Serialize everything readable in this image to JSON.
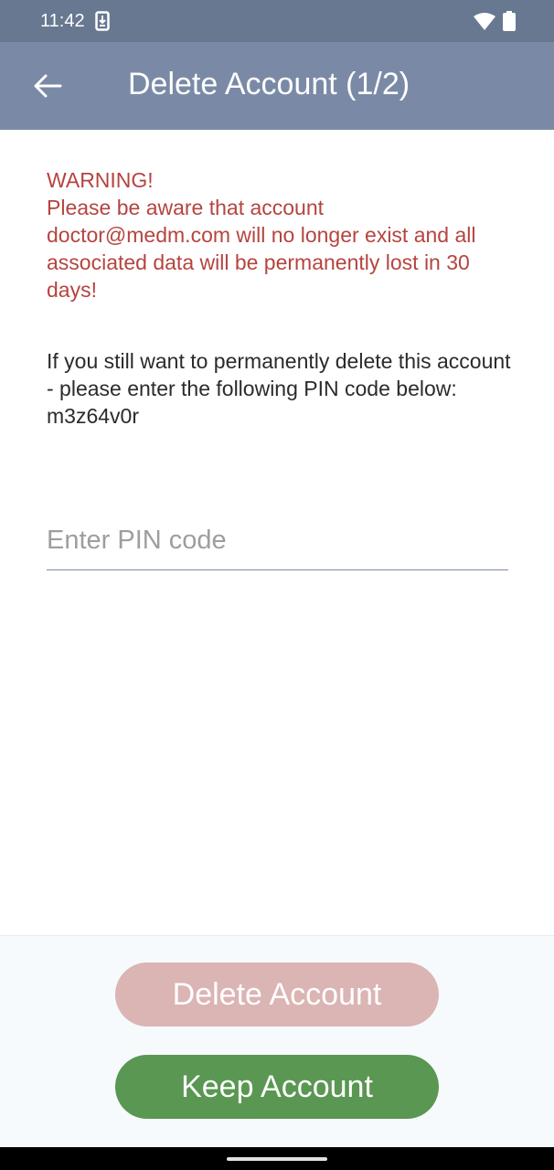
{
  "status_bar": {
    "time": "11:42",
    "icons": [
      "download-icon",
      "wifi-icon",
      "battery-icon"
    ]
  },
  "app_bar": {
    "title": "Delete Account (1/2)",
    "back_icon": "arrow-left-icon"
  },
  "warning": {
    "heading": "WARNING!",
    "message": "Please be aware that account doctor@medm.com will no longer exist and all associated data will be permanently lost in 30 days!"
  },
  "instructions": {
    "text": "If you still want to permanently delete this account - please enter the following PIN code below: m3z64v0r"
  },
  "pin_input": {
    "value": "",
    "placeholder": "Enter PIN code"
  },
  "buttons": {
    "delete_label": "Delete Account",
    "keep_label": "Keep Account"
  },
  "colors": {
    "status_bar": "#677890",
    "app_bar": "#7a8aa6",
    "warning_text": "#b5443f",
    "delete_button_disabled": "#dbb4b4",
    "keep_button": "#5a9752"
  }
}
